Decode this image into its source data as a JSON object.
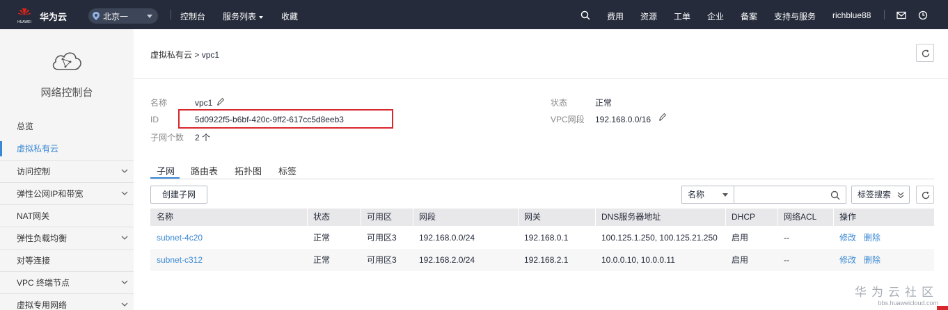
{
  "topbar": {
    "brand": "华为云",
    "logo_caption": "HUAWEI",
    "region": "北京一",
    "nav": {
      "console": "控制台",
      "services": "服务列表",
      "favorites": "收藏"
    },
    "right": {
      "fees": "费用",
      "resources": "资源",
      "tickets": "工单",
      "enterprise": "企业",
      "filing": "备案",
      "support": "支持与服务",
      "user": "richblue88"
    }
  },
  "sidebar": {
    "title": "网络控制台",
    "items": [
      {
        "label": "总览",
        "active": false,
        "expand": false
      },
      {
        "label": "虚拟私有云",
        "active": true,
        "expand": false
      },
      {
        "label": "访问控制",
        "active": false,
        "expand": true
      },
      {
        "label": "弹性公网IP和带宽",
        "active": false,
        "expand": true
      },
      {
        "label": "NAT网关",
        "active": false,
        "expand": false
      },
      {
        "label": "弹性负载均衡",
        "active": false,
        "expand": true
      },
      {
        "label": "对等连接",
        "active": false,
        "expand": false
      },
      {
        "label": "VPC 终端节点",
        "active": false,
        "expand": true
      },
      {
        "label": "虚拟专用网络",
        "active": false,
        "expand": true
      }
    ]
  },
  "breadcrumb": {
    "parent": "虚拟私有云",
    "separator": ">",
    "current": "vpc1"
  },
  "details": {
    "name_label": "名称",
    "name_value": "vpc1",
    "id_label": "ID",
    "id_value": "5d0922f5-b6bf-420c-9ff2-617cc5d8eeb3",
    "subnets_label": "子网个数",
    "subnets_value": "2 个",
    "status_label": "状态",
    "status_value": "正常",
    "cidr_label": "VPC网段",
    "cidr_value": "192.168.0.0/16"
  },
  "tabs": [
    "子网",
    "路由表",
    "拓扑图",
    "标签"
  ],
  "toolbar": {
    "create_subnet": "创建子网",
    "filter_field": "名称",
    "search_placeholder": "",
    "tag_search": "标签搜索"
  },
  "table": {
    "headers": [
      "名称",
      "状态",
      "可用区",
      "网段",
      "网关",
      "DNS服务器地址",
      "DHCP",
      "网络ACL",
      "操作"
    ],
    "rows": [
      {
        "name": "subnet-4c20",
        "status": "正常",
        "az": "可用区3",
        "cidr": "192.168.0.0/24",
        "gateway": "192.168.0.1",
        "dns": "100.125.1.250, 100.125.21.250",
        "dhcp": "启用",
        "acl": "--",
        "modify": "修改",
        "delete": "删除"
      },
      {
        "name": "subnet-c312",
        "status": "正常",
        "az": "可用区3",
        "cidr": "192.168.2.0/24",
        "gateway": "192.168.2.1",
        "dns": "10.0.0.10, 10.0.0.11",
        "dhcp": "启用",
        "acl": "--",
        "modify": "修改",
        "delete": "删除"
      }
    ]
  },
  "watermark": {
    "title": "华为云社区",
    "url": "bbs.huaweicloud.com"
  },
  "colors": {
    "topbar": "#252b3a",
    "accent": "#3a88d4",
    "highlight_box": "#d9262c"
  }
}
